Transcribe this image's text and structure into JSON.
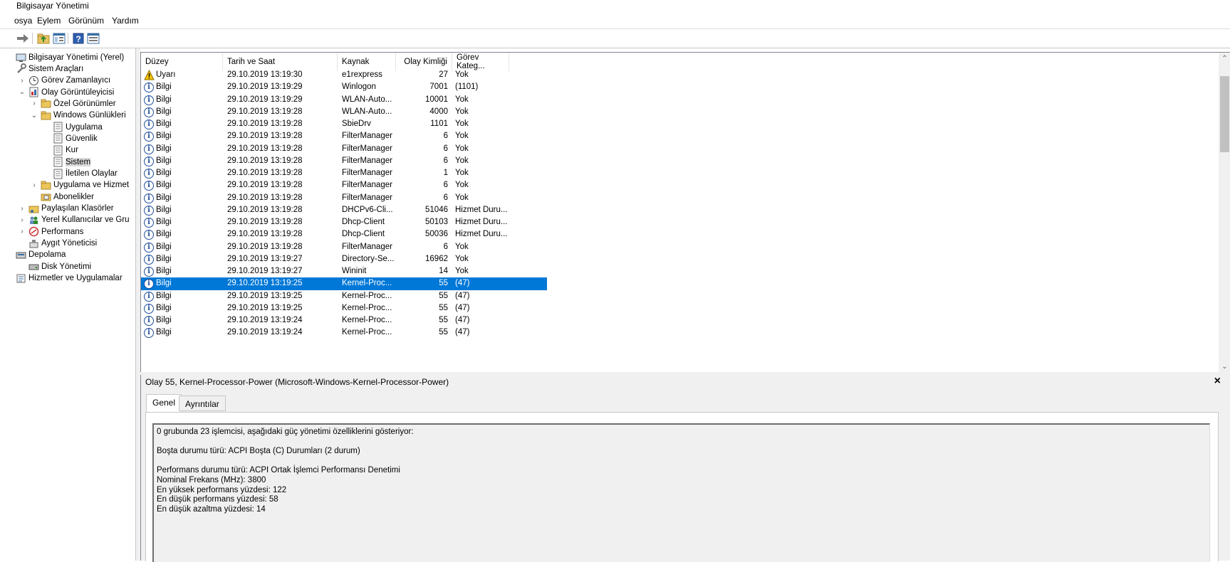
{
  "window": {
    "title": "Bilgisayar Yönetimi"
  },
  "menu": [
    "osya",
    "Eylem",
    "Görünüm",
    "Yardım"
  ],
  "toolbar": {
    "icons": [
      "back-arrow-icon",
      "up-folder-icon",
      "show-hide-tree-icon",
      "help-icon",
      "properties-icon"
    ]
  },
  "tree": [
    {
      "label": "Bilgisayar Yönetimi (Yerel)",
      "icon": "computer-management-icon",
      "indent": 0,
      "chev": ""
    },
    {
      "label": "Sistem Araçları",
      "icon": "tools-icon",
      "indent": 0,
      "chev": ""
    },
    {
      "label": "Görev Zamanlayıcı",
      "icon": "clock-icon",
      "indent": 1,
      "chev": "›"
    },
    {
      "label": "Olay Görüntüleyicisi",
      "icon": "event-viewer-icon",
      "indent": 1,
      "chev": "⌄"
    },
    {
      "label": "Özel Görünümler",
      "icon": "folder-icon",
      "indent": 2,
      "chev": "›"
    },
    {
      "label": "Windows Günlükleri",
      "icon": "folder-icon",
      "indent": 2,
      "chev": "⌄"
    },
    {
      "label": "Uygulama",
      "icon": "log-icon",
      "indent": 3,
      "chev": ""
    },
    {
      "label": "Güvenlik",
      "icon": "log-icon",
      "indent": 3,
      "chev": ""
    },
    {
      "label": "Kur",
      "icon": "log-icon",
      "indent": 3,
      "chev": ""
    },
    {
      "label": "Sistem",
      "icon": "log-icon",
      "indent": 3,
      "chev": "",
      "selected": true
    },
    {
      "label": "İletilen Olaylar",
      "icon": "log-icon",
      "indent": 3,
      "chev": ""
    },
    {
      "label": "Uygulama ve Hizmet",
      "icon": "folder-icon",
      "indent": 2,
      "chev": "›"
    },
    {
      "label": "Abonelikler",
      "icon": "subscriptions-icon",
      "indent": 2,
      "chev": ""
    },
    {
      "label": "Paylaşılan Klasörler",
      "icon": "shared-folder-icon",
      "indent": 1,
      "chev": "›"
    },
    {
      "label": "Yerel Kullanıcılar ve Gru",
      "icon": "users-icon",
      "indent": 1,
      "chev": "›"
    },
    {
      "label": "Performans",
      "icon": "performance-icon",
      "indent": 1,
      "chev": "›"
    },
    {
      "label": "Aygıt Yöneticisi",
      "icon": "device-manager-icon",
      "indent": 1,
      "chev": ""
    },
    {
      "label": "Depolama",
      "icon": "storage-icon",
      "indent": 0,
      "chev": ""
    },
    {
      "label": "Disk Yönetimi",
      "icon": "disk-icon",
      "indent": 1,
      "chev": ""
    },
    {
      "label": "Hizmetler ve Uygulamalar",
      "icon": "services-icon",
      "indent": 0,
      "chev": ""
    }
  ],
  "columns": [
    "Düzey",
    "Tarih ve Saat",
    "Kaynak",
    "Olay Kimliği",
    "Görev Kateg..."
  ],
  "events": [
    {
      "level": "Uyarı",
      "icon": "warning-icon",
      "date": "29.10.2019 13:19:30",
      "source": "e1rexpress",
      "id": "27",
      "task": "Yok"
    },
    {
      "level": "Bilgi",
      "icon": "info-icon",
      "date": "29.10.2019 13:19:29",
      "source": "Winlogon",
      "id": "7001",
      "task": "(1101)"
    },
    {
      "level": "Bilgi",
      "icon": "info-icon",
      "date": "29.10.2019 13:19:29",
      "source": "WLAN-Auto...",
      "id": "10001",
      "task": "Yok"
    },
    {
      "level": "Bilgi",
      "icon": "info-icon",
      "date": "29.10.2019 13:19:28",
      "source": "WLAN-Auto...",
      "id": "4000",
      "task": "Yok"
    },
    {
      "level": "Bilgi",
      "icon": "info-icon",
      "date": "29.10.2019 13:19:28",
      "source": "SbieDrv",
      "id": "1101",
      "task": "Yok"
    },
    {
      "level": "Bilgi",
      "icon": "info-icon",
      "date": "29.10.2019 13:19:28",
      "source": "FilterManager",
      "id": "6",
      "task": "Yok"
    },
    {
      "level": "Bilgi",
      "icon": "info-icon",
      "date": "29.10.2019 13:19:28",
      "source": "FilterManager",
      "id": "6",
      "task": "Yok"
    },
    {
      "level": "Bilgi",
      "icon": "info-icon",
      "date": "29.10.2019 13:19:28",
      "source": "FilterManager",
      "id": "6",
      "task": "Yok"
    },
    {
      "level": "Bilgi",
      "icon": "info-icon",
      "date": "29.10.2019 13:19:28",
      "source": "FilterManager",
      "id": "1",
      "task": "Yok"
    },
    {
      "level": "Bilgi",
      "icon": "info-icon",
      "date": "29.10.2019 13:19:28",
      "source": "FilterManager",
      "id": "6",
      "task": "Yok"
    },
    {
      "level": "Bilgi",
      "icon": "info-icon",
      "date": "29.10.2019 13:19:28",
      "source": "FilterManager",
      "id": "6",
      "task": "Yok"
    },
    {
      "level": "Bilgi",
      "icon": "info-icon",
      "date": "29.10.2019 13:19:28",
      "source": "DHCPv6-Cli...",
      "id": "51046",
      "task": "Hizmet Duru..."
    },
    {
      "level": "Bilgi",
      "icon": "info-icon",
      "date": "29.10.2019 13:19:28",
      "source": "Dhcp-Client",
      "id": "50103",
      "task": "Hizmet Duru..."
    },
    {
      "level": "Bilgi",
      "icon": "info-icon",
      "date": "29.10.2019 13:19:28",
      "source": "Dhcp-Client",
      "id": "50036",
      "task": "Hizmet Duru..."
    },
    {
      "level": "Bilgi",
      "icon": "info-icon",
      "date": "29.10.2019 13:19:28",
      "source": "FilterManager",
      "id": "6",
      "task": "Yok"
    },
    {
      "level": "Bilgi",
      "icon": "info-icon",
      "date": "29.10.2019 13:19:27",
      "source": "Directory-Se...",
      "id": "16962",
      "task": "Yok"
    },
    {
      "level": "Bilgi",
      "icon": "info-icon",
      "date": "29.10.2019 13:19:27",
      "source": "Wininit",
      "id": "14",
      "task": "Yok"
    },
    {
      "level": "Bilgi",
      "icon": "info-icon",
      "date": "29.10.2019 13:19:25",
      "source": "Kernel-Proc...",
      "id": "55",
      "task": "(47)",
      "selected": true
    },
    {
      "level": "Bilgi",
      "icon": "info-icon",
      "date": "29.10.2019 13:19:25",
      "source": "Kernel-Proc...",
      "id": "55",
      "task": "(47)"
    },
    {
      "level": "Bilgi",
      "icon": "info-icon",
      "date": "29.10.2019 13:19:25",
      "source": "Kernel-Proc...",
      "id": "55",
      "task": "(47)"
    },
    {
      "level": "Bilgi",
      "icon": "info-icon",
      "date": "29.10.2019 13:19:24",
      "source": "Kernel-Proc...",
      "id": "55",
      "task": "(47)"
    },
    {
      "level": "Bilgi",
      "icon": "info-icon",
      "date": "29.10.2019 13:19:24",
      "source": "Kernel-Proc...",
      "id": "55",
      "task": "(47)"
    }
  ],
  "detail": {
    "title": "Olay 55, Kernel-Processor-Power (Microsoft-Windows-Kernel-Processor-Power)",
    "close": "×",
    "tabs": [
      "Genel",
      "Ayrıntılar"
    ],
    "message_lines": [
      "0 grubunda 23 işlemcisi, aşağıdaki güç yönetimi özelliklerini gösteriyor:",
      "",
      "Boşta durumu türü: ACPI Boşta (C) Durumları (2 durum)",
      "",
      "Performans durumu türü: ACPI Ortak İşlemci Performansı Denetimi",
      "Nominal Frekans (MHz): 3800",
      "En yüksek performans yüzdesi: 122",
      "En düşük performans yüzdesi: 58",
      "En düşük azaltma yüzdesi: 14"
    ]
  },
  "colors": {
    "selection": "#0078d7",
    "info_blue": "#1f4e9c",
    "warning_yellow": "#f5c400"
  }
}
